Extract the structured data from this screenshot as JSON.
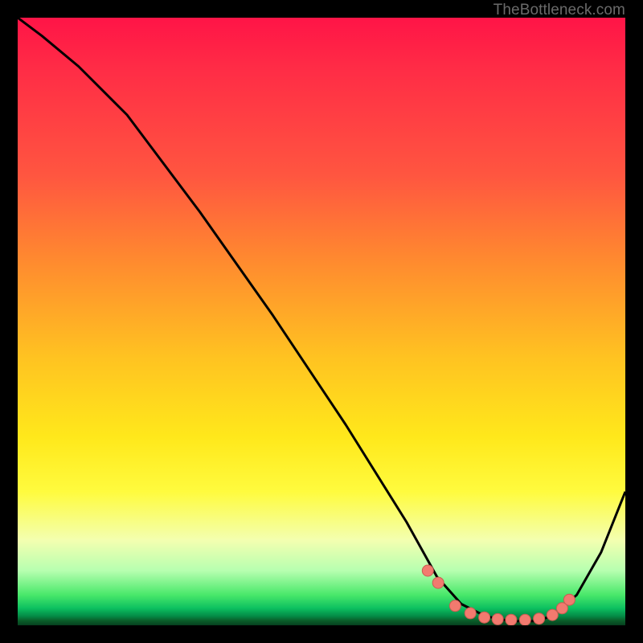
{
  "attribution": "TheBottleneck.com",
  "chart_data": {
    "type": "line",
    "title": "",
    "xlabel": "",
    "ylabel": "",
    "xlim": [
      0,
      100
    ],
    "ylim": [
      0,
      100
    ],
    "background_gradient_stops": [
      {
        "pos": 0,
        "color": "#ff1447"
      },
      {
        "pos": 8,
        "color": "#ff2b46"
      },
      {
        "pos": 26,
        "color": "#ff5640"
      },
      {
        "pos": 40,
        "color": "#ff8a2f"
      },
      {
        "pos": 56,
        "color": "#ffc321"
      },
      {
        "pos": 69,
        "color": "#ffe81b"
      },
      {
        "pos": 78,
        "color": "#fffb3e"
      },
      {
        "pos": 86,
        "color": "#f3ffb0"
      },
      {
        "pos": 91,
        "color": "#b7ffb0"
      },
      {
        "pos": 95,
        "color": "#49e86a"
      },
      {
        "pos": 97.2,
        "color": "#0cc060"
      },
      {
        "pos": 98.5,
        "color": "#048a46"
      },
      {
        "pos": 99.2,
        "color": "#0a5f2a"
      },
      {
        "pos": 100,
        "color": "#06401e"
      }
    ],
    "series": [
      {
        "name": "bottleneck-curve",
        "x": [
          0,
          4,
          10,
          18,
          30,
          42,
          54,
          64,
          69,
          73,
          77,
          81,
          85,
          88,
          92,
          96,
          100
        ],
        "y": [
          100,
          97,
          92,
          84,
          68,
          51,
          33,
          17,
          8,
          3.5,
          1.5,
          0.7,
          0.7,
          1.5,
          5,
          12,
          22
        ]
      }
    ],
    "markers": {
      "name": "trough-dots",
      "color": "#f27a6f",
      "x": [
        67.5,
        69.2,
        72.0,
        74.5,
        76.8,
        79.0,
        81.2,
        83.5,
        85.8,
        88.0,
        89.6,
        90.8
      ],
      "y": [
        9.0,
        7.0,
        3.2,
        2.0,
        1.3,
        1.0,
        0.9,
        0.9,
        1.1,
        1.7,
        2.8,
        4.2
      ]
    }
  }
}
